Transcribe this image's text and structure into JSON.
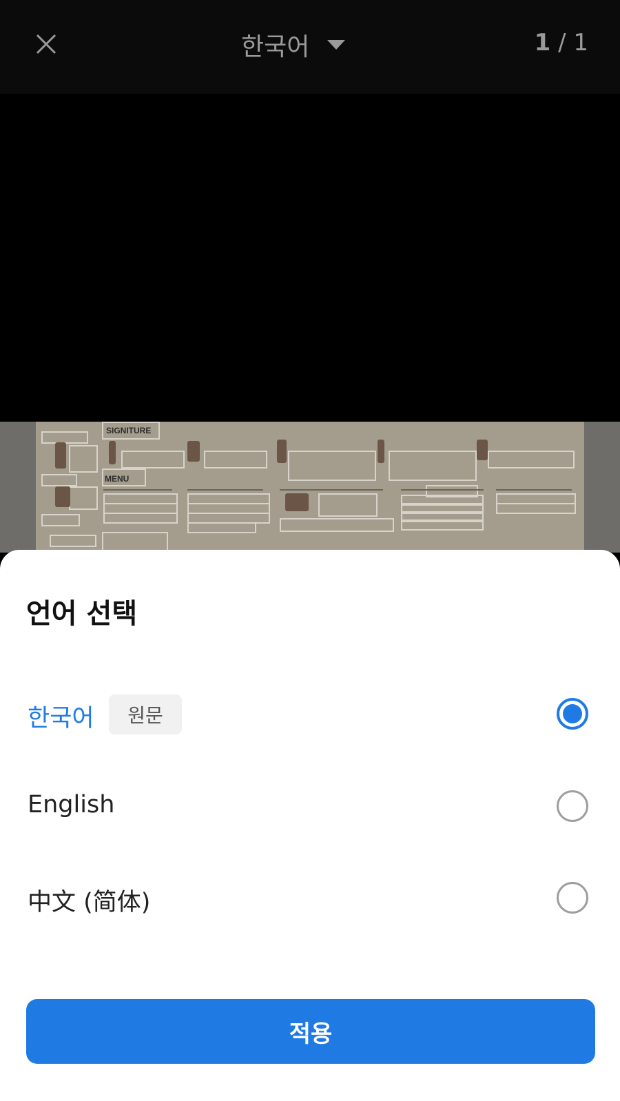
{
  "header": {
    "language": "한국어",
    "page_current": "1",
    "page_sep": " / 1"
  },
  "background_menu": {
    "signature_label": "SIGNITURE",
    "menu_label": "MENU"
  },
  "sheet": {
    "title": "언어 선택",
    "options": [
      {
        "label": "한국어",
        "badge": "원문",
        "selected": true
      },
      {
        "label": "English",
        "selected": false
      },
      {
        "label": "中文 (简体)",
        "selected": false
      }
    ],
    "apply_label": "적용"
  },
  "colors": {
    "accent": "#1f7be3"
  }
}
